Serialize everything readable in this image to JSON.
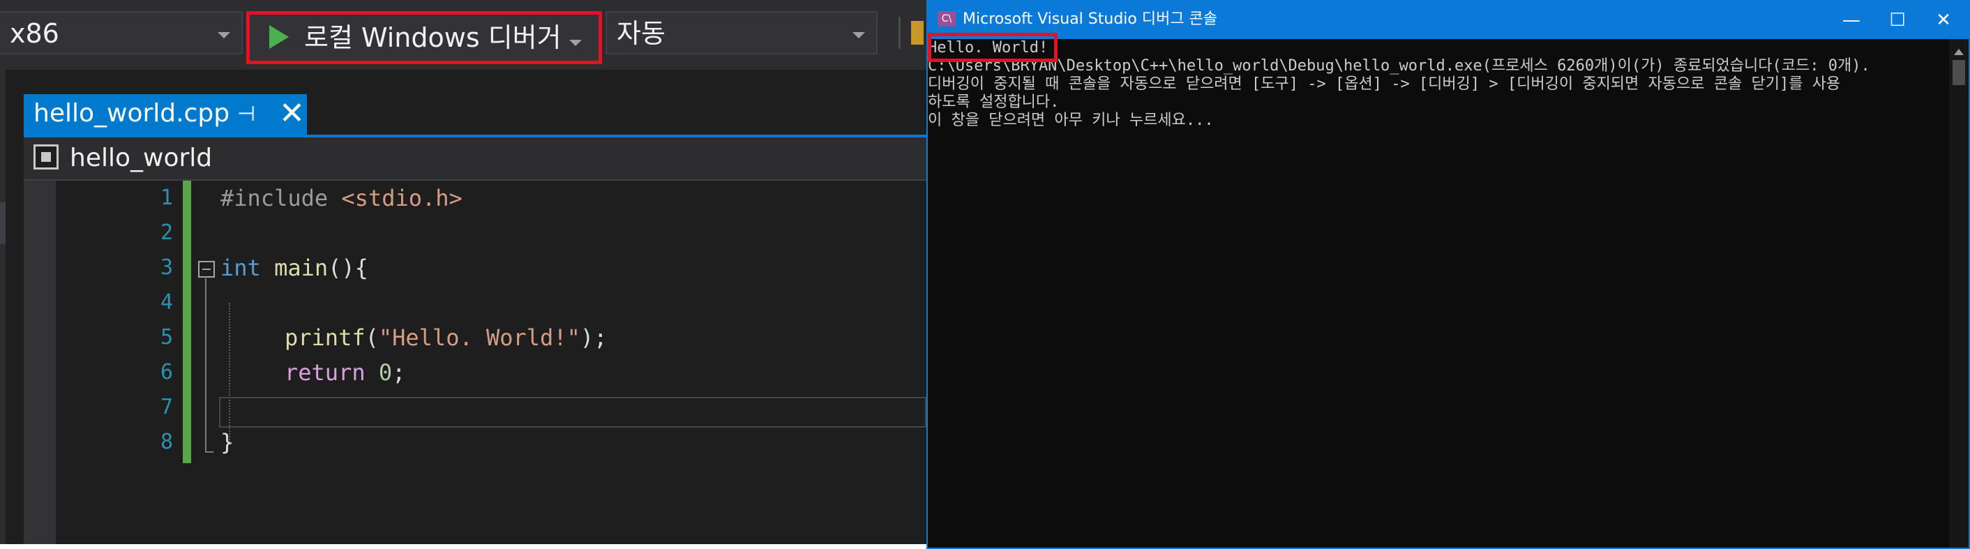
{
  "vs": {
    "toolbar": {
      "platform": "x86",
      "debugger": "로컬 Windows 디버거",
      "configuration": "자동"
    },
    "tab": {
      "filename": "hello_world.cpp",
      "pin": "⊣",
      "close": "✕"
    },
    "navbar": {
      "scope": "hello_world"
    },
    "editor": {
      "line_numbers": [
        "1",
        "2",
        "3",
        "4",
        "5",
        "6",
        "7",
        "8"
      ],
      "lines": {
        "l1_directive": "#include",
        "l1_header": " <stdio.h>",
        "l3_type": "int",
        "l3_func": " main",
        "l3_punc": "(){",
        "l5_func": "printf",
        "l5_open": "(",
        "l5_str": "\"Hello. World!\"",
        "l5_close": ");",
        "l6_kw": "return",
        "l6_num": " 0",
        "l6_punc": ";",
        "l8_punc": "}"
      }
    }
  },
  "console": {
    "icon": "C\\",
    "title": "Microsoft Visual Studio 디버그 콘솔",
    "buttons": {
      "minimize": "—",
      "maximize": "☐",
      "close": "✕"
    },
    "lines": [
      "Hello. World!",
      "C:\\Users\\BRYAN\\Desktop\\C++\\hello_world\\Debug\\hello_world.exe(프로세스 6260개)이(가) 종료되었습니다(코드: 0개).",
      "디버깅이 중지될 때 콘솔을 자동으로 닫으려면 [도구] -> [옵션] -> [디버깅] > [디버깅이 중지되면 자동으로 콘솔 닫기]를 사용",
      "하도록 설정합니다.",
      "이 창을 닫으려면 아무 키나 누르세요..."
    ]
  },
  "colors": {
    "highlight": "#e81123",
    "vs_accent": "#007acc",
    "console_border": "#0a79d8"
  }
}
